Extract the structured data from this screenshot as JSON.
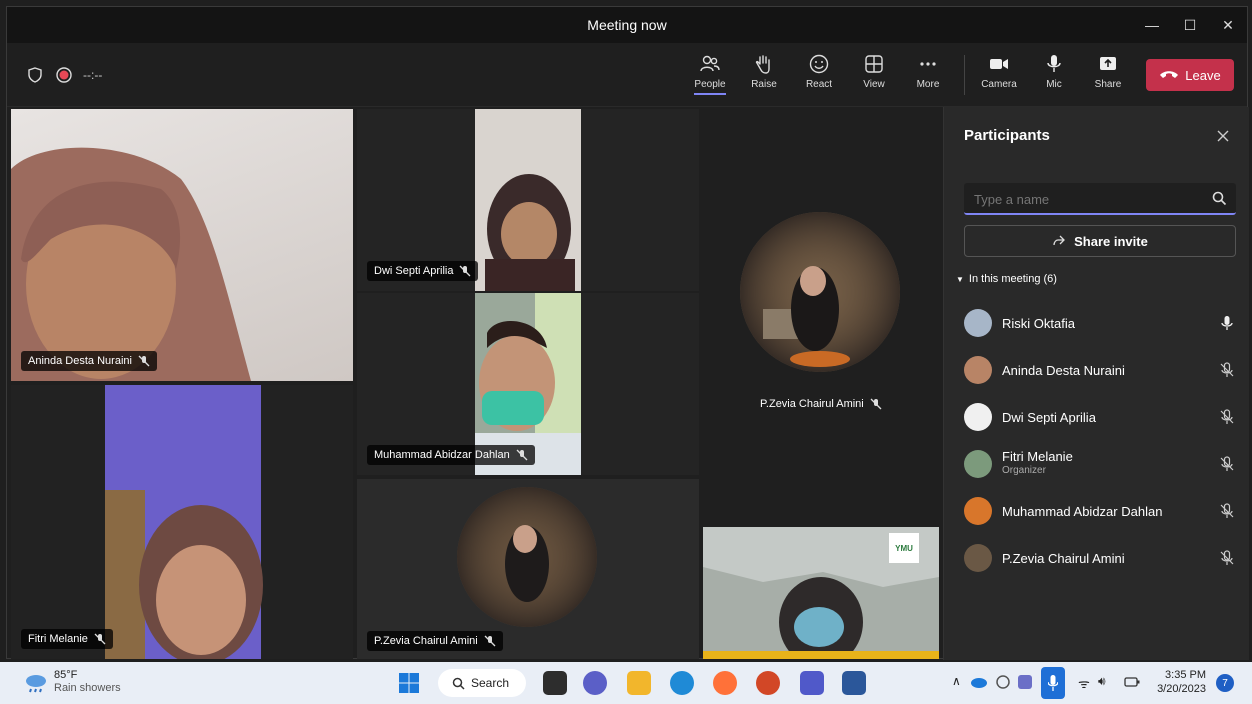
{
  "window": {
    "title": "Meeting now"
  },
  "toolbar": {
    "timer": "--:--",
    "items": [
      {
        "label": "People"
      },
      {
        "label": "Raise"
      },
      {
        "label": "React"
      },
      {
        "label": "View"
      },
      {
        "label": "More"
      },
      {
        "label": "Camera"
      },
      {
        "label": "Mic"
      },
      {
        "label": "Share"
      }
    ],
    "leave_label": "Leave"
  },
  "tiles": [
    {
      "name": "Aninda Desta Nuraini"
    },
    {
      "name": "Dwi Septi Aprilia"
    },
    {
      "name": "Muhammad Abidzar Dahlan"
    },
    {
      "name": "P.Zevia Chairul Amini"
    },
    {
      "name": "Fitri Melanie"
    },
    {
      "name": "P.Zevia Chairul Amini"
    }
  ],
  "shared_content": {
    "logo_text": "YMU"
  },
  "panel": {
    "title": "Participants",
    "search_placeholder": "Type a name",
    "share_invite": "Share invite",
    "section_label": "In this meeting (6)",
    "participants": [
      {
        "name": "Riski Oktafia",
        "role": "",
        "mic": "on"
      },
      {
        "name": "Aninda Desta Nuraini",
        "role": "",
        "mic": "muted"
      },
      {
        "name": "Dwi Septi Aprilia",
        "role": "",
        "mic": "muted"
      },
      {
        "name": "Fitri Melanie",
        "role": "Organizer",
        "mic": "muted"
      },
      {
        "name": "Muhammad Abidzar Dahlan",
        "role": "",
        "mic": "muted"
      },
      {
        "name": "P.Zevia Chairul Amini",
        "role": "",
        "mic": "muted"
      }
    ]
  },
  "taskbar": {
    "weather_temp": "85°F",
    "weather_desc": "Rain showers",
    "search_label": "Search",
    "time": "3:35 PM",
    "date": "3/20/2023",
    "notification_count": "7"
  },
  "colors": {
    "accent": "#7f85f5",
    "leave": "#c4314b"
  }
}
